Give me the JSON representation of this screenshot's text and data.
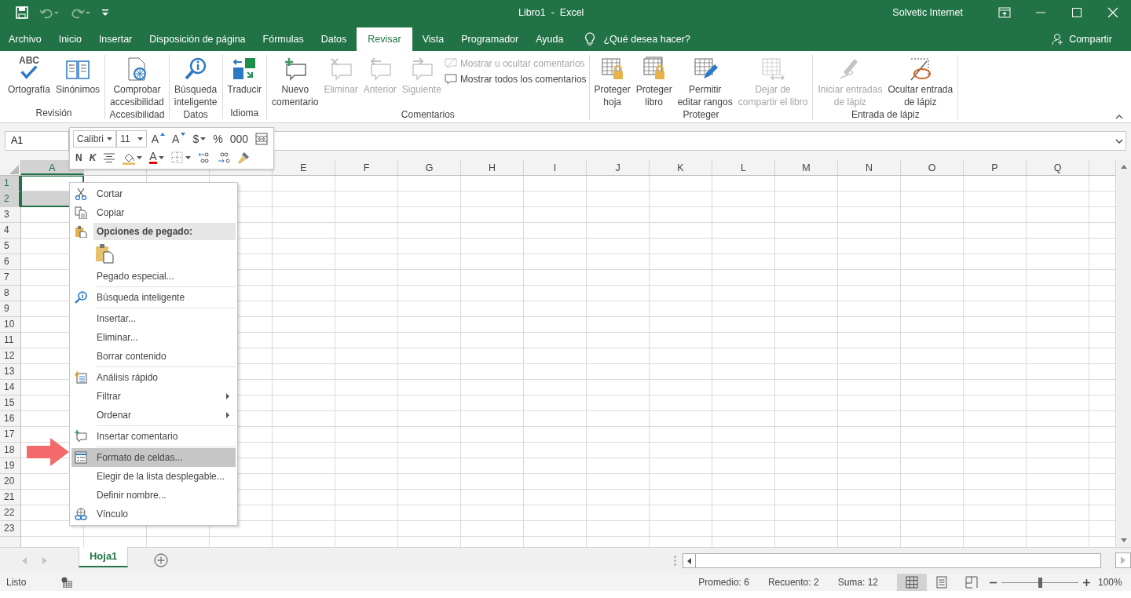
{
  "window": {
    "title": "Libro1  -  Excel",
    "user": "Solvetic Internet"
  },
  "menu_tabs": [
    {
      "label": "Archivo",
      "selected": false
    },
    {
      "label": "Inicio",
      "selected": false
    },
    {
      "label": "Insertar",
      "selected": false
    },
    {
      "label": "Disposición de página",
      "selected": false
    },
    {
      "label": "Fórmulas",
      "selected": false
    },
    {
      "label": "Datos",
      "selected": false
    },
    {
      "label": "Revisar",
      "selected": true
    },
    {
      "label": "Vista",
      "selected": false
    },
    {
      "label": "Programador",
      "selected": false
    },
    {
      "label": "Ayuda",
      "selected": false
    }
  ],
  "tell_me": {
    "placeholder": "¿Qué desea hacer?"
  },
  "share": "Compartir",
  "ribbon_groups": [
    {
      "label": "Revisión",
      "buttons": [
        {
          "kind": "large",
          "label": "Ortografía",
          "icon_text": "ABC",
          "disabled": false
        },
        {
          "kind": "large",
          "label": "Sinónimos",
          "disabled": false
        }
      ]
    },
    {
      "label": "Accesibilidad",
      "buttons": [
        {
          "kind": "large",
          "label": "Comprobar\naccesibilidad",
          "disabled": false
        }
      ]
    },
    {
      "label": "Datos",
      "buttons": [
        {
          "kind": "large",
          "label": "Búsqueda\ninteligente",
          "disabled": false
        }
      ]
    },
    {
      "label": "Idioma",
      "buttons": [
        {
          "kind": "large",
          "label": "Traducir",
          "disabled": false
        }
      ]
    },
    {
      "label": "Comentarios",
      "buttons": [
        {
          "kind": "large",
          "label": "Nuevo\ncomentario",
          "disabled": false
        },
        {
          "kind": "large",
          "label": "Eliminar",
          "disabled": true
        },
        {
          "kind": "large",
          "label": "Anterior",
          "disabled": true
        },
        {
          "kind": "large",
          "label": "Siguiente",
          "disabled": true
        },
        {
          "kind": "small",
          "label": "Mostrar u ocultar comentarios",
          "disabled": true
        },
        {
          "kind": "small",
          "label": "Mostrar todos los comentarios",
          "disabled": false
        }
      ]
    },
    {
      "label": "Proteger",
      "buttons": [
        {
          "kind": "large",
          "label": "Proteger\nhoja",
          "disabled": false
        },
        {
          "kind": "large",
          "label": "Proteger\nlibro",
          "disabled": false
        },
        {
          "kind": "large",
          "label": "Permitir\neditar rangos",
          "disabled": false
        },
        {
          "kind": "large",
          "label": "Dejar de\ncompartir el libro",
          "disabled": true
        }
      ]
    },
    {
      "label": "Entrada de lápiz",
      "buttons": [
        {
          "kind": "large",
          "label": "Iniciar entradas\nde lápiz",
          "disabled": true
        },
        {
          "kind": "large",
          "label": "Ocultar entrada\nde lápiz",
          "disabled": false
        }
      ]
    }
  ],
  "name_box": "A1",
  "mini_toolbar": {
    "font": "Calibri",
    "size": "11",
    "row1": [
      {
        "kind": "grow",
        "label": "A"
      },
      {
        "kind": "shrink",
        "label": "A"
      },
      {
        "kind": "drop",
        "label": "$"
      },
      {
        "kind": "text",
        "label": "%"
      },
      {
        "kind": "text",
        "label": "000"
      },
      {
        "kind": "icon"
      }
    ],
    "row2": [
      {
        "kind": "bold",
        "label": "N"
      },
      {
        "kind": "italic",
        "label": "K"
      },
      {
        "kind": "icon"
      },
      {
        "kind": "icon"
      },
      {
        "kind": "fontcolor",
        "label": "A"
      },
      {
        "kind": "icon"
      },
      {
        "kind": "icon"
      },
      {
        "kind": "icon"
      },
      {
        "kind": "icon"
      }
    ]
  },
  "columns": [
    {
      "label": "A",
      "selected": true
    },
    {
      "selected": false
    },
    {
      "selected": false
    },
    {
      "selected": false
    },
    {
      "label": "E",
      "selected": false
    },
    {
      "label": "F",
      "selected": false
    },
    {
      "label": "G",
      "selected": false
    },
    {
      "label": "H",
      "selected": false
    },
    {
      "label": "I",
      "selected": false
    },
    {
      "label": "J",
      "selected": false
    },
    {
      "label": "K",
      "selected": false
    },
    {
      "label": "L",
      "selected": false
    },
    {
      "label": "M",
      "selected": false
    },
    {
      "label": "N",
      "selected": false
    },
    {
      "label": "O",
      "selected": false
    },
    {
      "label": "P",
      "selected": false
    },
    {
      "label": "Q",
      "selected": false
    }
  ],
  "rows": [
    {
      "label": "1",
      "selected": true
    },
    {
      "label": "2",
      "selected": true
    },
    {
      "label": "3",
      "selected": false
    },
    {
      "label": "4",
      "selected": false
    },
    {
      "label": "5",
      "selected": false
    },
    {
      "label": "6",
      "selected": false
    },
    {
      "label": "7",
      "selected": false
    },
    {
      "label": "8",
      "selected": false
    },
    {
      "label": "9",
      "selected": false
    },
    {
      "label": "10",
      "selected": false
    },
    {
      "label": "11",
      "selected": false
    },
    {
      "label": "12",
      "selected": false
    },
    {
      "label": "13",
      "selected": false
    },
    {
      "label": "14",
      "selected": false
    },
    {
      "label": "15",
      "selected": false
    },
    {
      "label": "16",
      "selected": false
    },
    {
      "label": "17",
      "selected": false
    },
    {
      "label": "18",
      "selected": false
    },
    {
      "label": "19",
      "selected": false
    },
    {
      "label": "20",
      "selected": false
    },
    {
      "label": "21",
      "selected": false
    },
    {
      "label": "22",
      "selected": false
    },
    {
      "label": "23",
      "selected": false
    }
  ],
  "context_menu": [
    {
      "kind": "item",
      "label": "Cortar",
      "submenu": false,
      "selected": false
    },
    {
      "kind": "item",
      "label": "Copiar",
      "submenu": false,
      "selected": false
    },
    {
      "kind": "header",
      "label": "Opciones de pegado:"
    },
    {
      "kind": "paste_options"
    },
    {
      "kind": "item",
      "label": "Pegado especial...",
      "submenu": false,
      "selected": false
    },
    {
      "kind": "separator"
    },
    {
      "kind": "item",
      "label": "Búsqueda inteligente",
      "submenu": false,
      "selected": false
    },
    {
      "kind": "separator"
    },
    {
      "kind": "item",
      "label": "Insertar...",
      "submenu": false,
      "selected": false
    },
    {
      "kind": "item",
      "label": "Eliminar...",
      "submenu": false,
      "selected": false
    },
    {
      "kind": "item",
      "label": "Borrar contenido",
      "submenu": false,
      "selected": false
    },
    {
      "kind": "separator"
    },
    {
      "kind": "item",
      "label": "Análisis rápido",
      "submenu": false,
      "selected": false
    },
    {
      "kind": "item",
      "label": "Filtrar",
      "submenu": true,
      "selected": false
    },
    {
      "kind": "item",
      "label": "Ordenar",
      "submenu": true,
      "selected": false
    },
    {
      "kind": "separator"
    },
    {
      "kind": "item",
      "label": "Insertar comentario",
      "submenu": false,
      "selected": false
    },
    {
      "kind": "separator"
    },
    {
      "kind": "item",
      "label": "Formato de celdas...",
      "submenu": false,
      "selected": true
    },
    {
      "kind": "item",
      "label": "Elegir de la lista desplegable...",
      "submenu": false,
      "selected": false
    },
    {
      "kind": "item",
      "label": "Definir nombre...",
      "submenu": false,
      "selected": false
    },
    {
      "kind": "item",
      "label": "Vínculo",
      "submenu": false,
      "selected": false
    }
  ],
  "sheet_tabs": [
    {
      "label": "Hoja1",
      "selected": true
    }
  ],
  "status_bar": {
    "mode": "Listo",
    "stats": [
      "Promedio: 6",
      "Recuento: 2",
      "Suma: 12"
    ],
    "view_buttons": [
      {
        "selected": true
      },
      {
        "selected": false
      },
      {
        "selected": false
      }
    ],
    "zoom": {
      "level": 0.5,
      "reading": "100%"
    }
  }
}
